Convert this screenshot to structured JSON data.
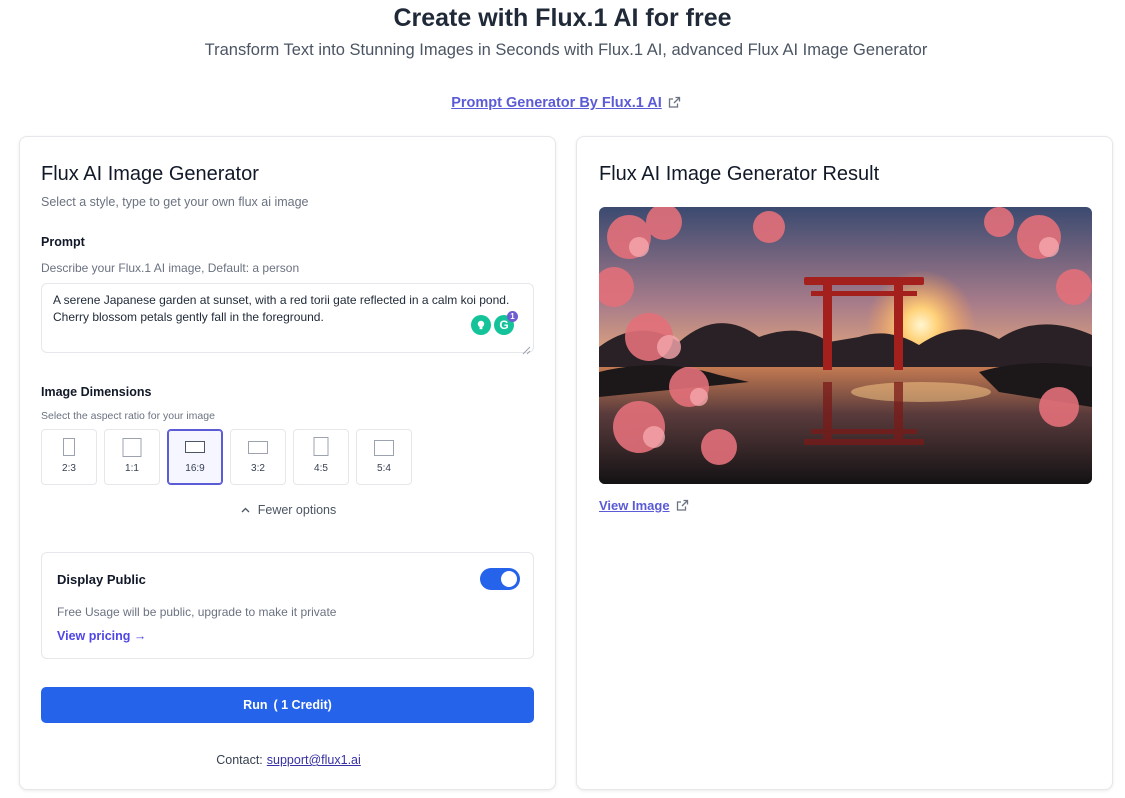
{
  "hero": {
    "title": "Create with Flux.1 AI for free",
    "subtitle": "Transform Text into Stunning Images in Seconds with Flux.1 AI, advanced Flux AI Image Generator",
    "prompt_generator_link": "Prompt Generator By Flux.1 AI"
  },
  "generator": {
    "title": "Flux AI Image Generator",
    "description": "Select a style, type to get your own flux ai image",
    "prompt_label": "Prompt",
    "prompt_hint": "Describe your Flux.1 AI image, Default: a person",
    "prompt_value": "A serene Japanese garden at sunset, with a red torii gate reflected in a calm koi pond. Cherry blossom petals gently fall in the foreground.",
    "grammarly_badge": "1",
    "dimensions_label": "Image Dimensions",
    "dimensions_hint": "Select the aspect ratio for your image",
    "ratios": [
      {
        "label": "2:3",
        "active": false
      },
      {
        "label": "1:1",
        "active": false
      },
      {
        "label": "16:9",
        "active": true
      },
      {
        "label": "3:2",
        "active": false
      },
      {
        "label": "4:5",
        "active": false
      },
      {
        "label": "5:4",
        "active": false
      }
    ],
    "fewer_options": "Fewer options",
    "display_public": {
      "title": "Display Public",
      "enabled": true,
      "description": "Free Usage will be public, upgrade to make it private",
      "pricing_link": "View pricing →"
    },
    "run_button": {
      "label": "Run",
      "credit": "( 1 Credit)"
    },
    "contact": {
      "label": "Contact:",
      "email": "support@flux1.ai"
    }
  },
  "result": {
    "title": "Flux AI Image Generator Result",
    "view_link": "View Image"
  },
  "colors": {
    "primary": "#2563eb",
    "link": "#5b5bd6",
    "border": "#e5e7eb"
  }
}
